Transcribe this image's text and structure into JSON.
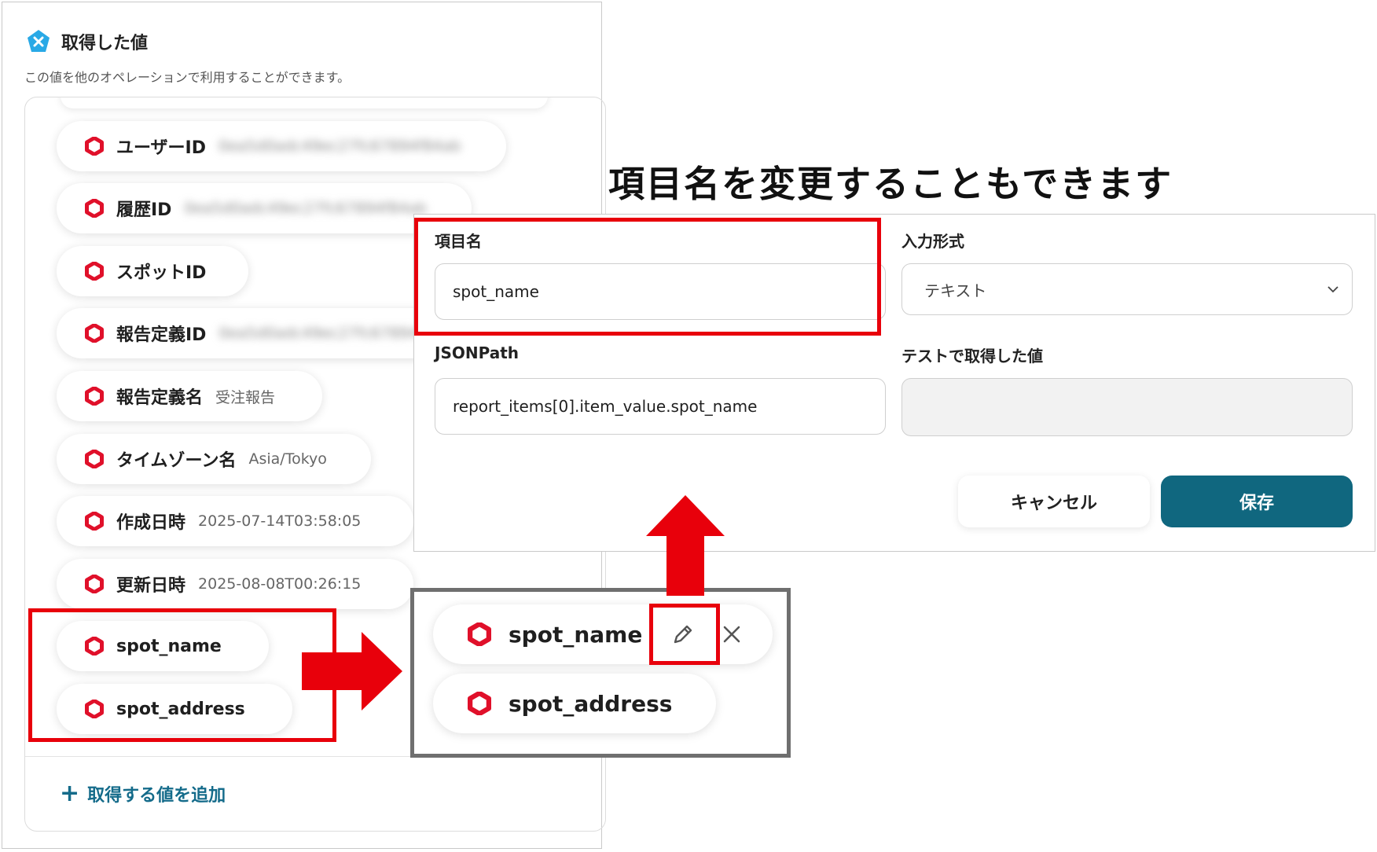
{
  "left_panel": {
    "title": "取得した値",
    "subtitle": "この値を他のオペレーションで利用することができます。",
    "items": [
      {
        "label": "ユーザーID",
        "value": "0ea5d0adc49ec27fc67894f84ab"
      },
      {
        "label": "履歴ID",
        "value": "0ea5d0adc49ec27fc67894f84ab"
      },
      {
        "label": "スポットID",
        "value": ""
      },
      {
        "label": "報告定義ID",
        "value": "0ea5d0adc49ec27fc67894f84ab"
      },
      {
        "label": "報告定義名",
        "value": "受注報告"
      },
      {
        "label": "タイムゾーン名",
        "value": "Asia/Tokyo"
      },
      {
        "label": "作成日時",
        "value": "2025-07-14T03:58:05"
      },
      {
        "label": "更新日時",
        "value": "2025-08-08T00:26:15"
      },
      {
        "label": "spot_name",
        "value": ""
      },
      {
        "label": "spot_address",
        "value": ""
      }
    ],
    "add_label": "取得する値を追加"
  },
  "headline": "項目名を変更することもできます",
  "dialog": {
    "item_name_label": "項目名",
    "item_name_value": "spot_name",
    "input_type_label": "入力形式",
    "input_type_value": "テキスト",
    "jsonpath_label": "JSONPath",
    "jsonpath_value": "report_items[0].item_value.spot_name",
    "test_value_label": "テストで取得した値",
    "cancel_label": "キャンセル",
    "save_label": "保存"
  },
  "zoom": {
    "items": [
      "spot_name",
      "spot_address"
    ]
  },
  "colors": {
    "accent": "#10677f",
    "link": "#146b8a",
    "highlight": "#e8000b",
    "hex_icon": "#e0102a",
    "brand_badge": "#29a9e6"
  },
  "icons": [
    "brand-badge-icon",
    "hexagon-icon",
    "pencil-icon",
    "close-icon",
    "chevron-down-icon",
    "plus-icon",
    "arrow-right-icon",
    "arrow-up-icon"
  ]
}
